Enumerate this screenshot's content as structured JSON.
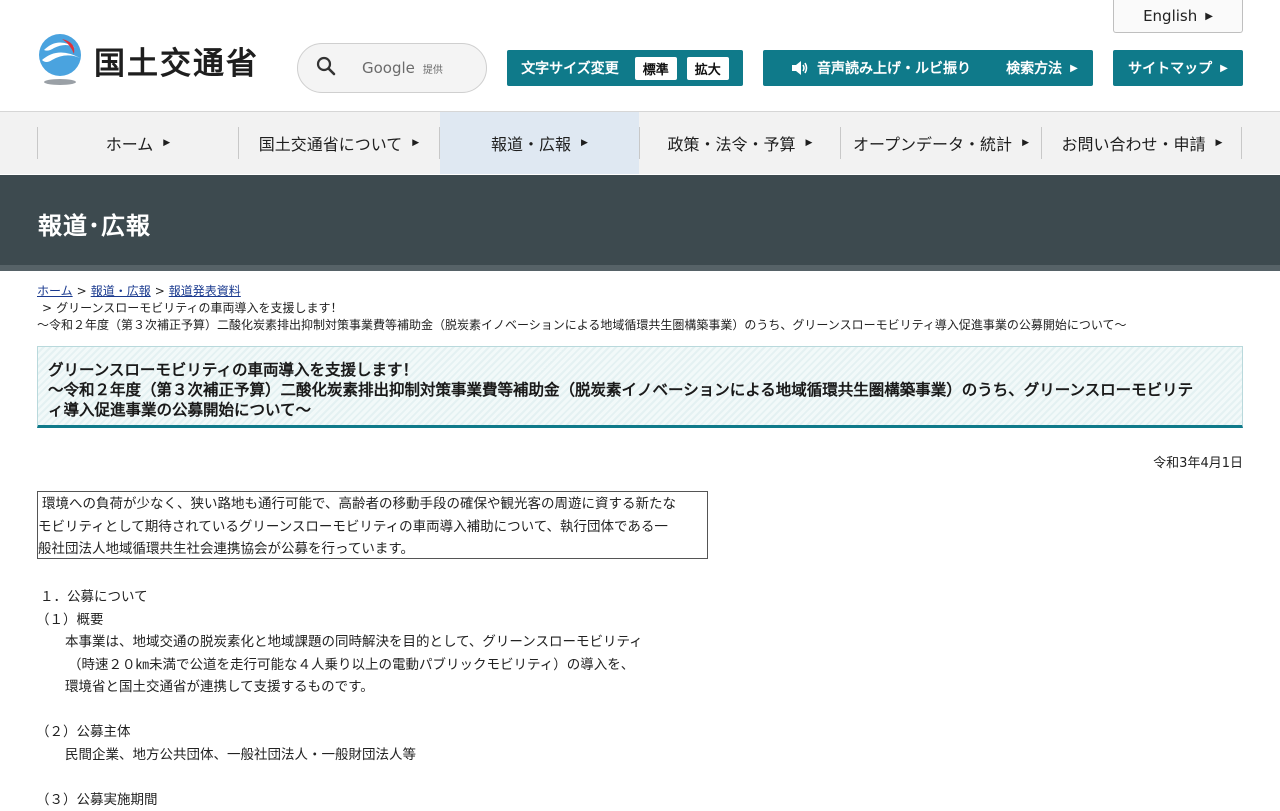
{
  "header": {
    "logo_text": "国土交通省",
    "english_label": "English",
    "search": {
      "brand": "Google",
      "sub": "提供"
    },
    "font_size": {
      "label": "文字サイズ変更",
      "standard": "標準",
      "large": "拡大"
    },
    "speech_label": "音声読み上げ・ルビ振り",
    "search_method_label": "検索方法",
    "sitemap_label": "サイトマップ"
  },
  "nav": {
    "items": [
      {
        "label": "ホーム"
      },
      {
        "label": "国土交通省について"
      },
      {
        "label": "報道・広報",
        "active": true
      },
      {
        "label": "政策・法令・予算"
      },
      {
        "label": "オープンデータ・統計"
      },
      {
        "label": "お問い合わせ・申請"
      }
    ]
  },
  "banner": {
    "title": "報道･広報"
  },
  "breadcrumb": {
    "home": "ホーム",
    "press": "報道・広報",
    "releases": "報道発表資料",
    "current_line1": "グリーンスローモビリティの車両導入を支援します！",
    "current_line2": "～令和２年度（第３次補正予算）二酸化炭素排出抑制対策事業費等補助金（脱炭素イノベーションによる地域循環共生圏構築事業）のうち、グリーンスローモビリティ導入促進事業の公募開始について～"
  },
  "article": {
    "title_line1": "グリーンスローモビリティの車両導入を支援します！",
    "title_line2": "～令和２年度（第３次補正予算）二酸化炭素排出抑制対策事業費等補助金（脱炭素イノベーションによる地域循環共生圏構築事業）のうち、グリーンスローモビリテ",
    "title_line3": "ィ導入促進事業の公募開始について～",
    "date": "令和3年4月1日",
    "notice_line1": "環境への負荷が少なく、狭い路地も通行可能で、高齢者の移動手段の確保や観光客の周遊に資する新たな",
    "notice_line2": "モビリティとして期待されているグリーンスローモビリティの車両導入補助について、執行団体である一",
    "notice_line3": "般社団法人地域循環共生社会連携協会が公募を行っています。",
    "sec1": "１．公募について",
    "sec1_1": "（１）概要",
    "p1_l1": "本事業は、地域交通の脱炭素化と地域課題の同時解決を目的として、グリーンスローモビリティ",
    "p1_l2": "（時速２０㎞未満で公道を走行可能な４人乗り以上の電動パブリックモビリティ）の導入を、",
    "p1_l3": "環境省と国土交通省が連携して支援するものです。",
    "sec1_2": "（２）公募主体",
    "p2_l1": "民間企業、地方公共団体、一般社団法人・一般財団法人等",
    "sec1_3": "（３）公募実施期間"
  },
  "colors": {
    "teal": "#0f7a8a",
    "banner": "#3d4a4f",
    "nav_bg": "#f2f2f2",
    "nav_active": "#dfe8f2"
  }
}
